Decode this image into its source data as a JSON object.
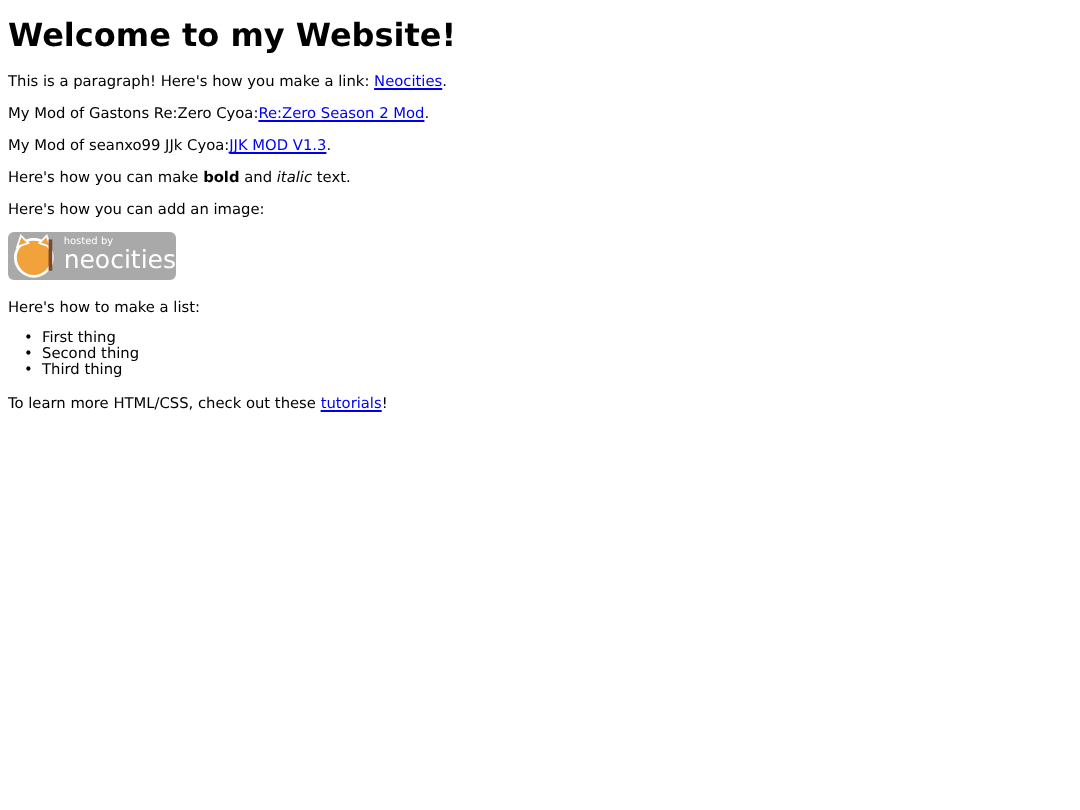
{
  "heading": "Welcome to my Website!",
  "blocks": [
    {
      "kind": "link_paragraph",
      "before": "This is a paragraph! Here's how you make a link: ",
      "link": "Neocities",
      "after": "."
    },
    {
      "kind": "link_paragraph",
      "before": "My Mod of Gastons Re:Zero Cyoa:",
      "link": "Re:Zero Season 2 Mod",
      "after": "."
    },
    {
      "kind": "link_paragraph",
      "before": "My Mod of seanxo99 JJk Cyoa:",
      "link": "JJK MOD V1.3",
      "after": "."
    },
    {
      "kind": "paragraph",
      "text": "Here's how you can make **bold** and *italic* text."
    },
    {
      "kind": "paragraph",
      "text": "Here's how you can add an image:"
    },
    {
      "kind": "badge",
      "small": "hosted by",
      "large": "neocities"
    },
    {
      "kind": "paragraph",
      "text": "Here's how to make a list:"
    },
    {
      "kind": "list",
      "items": [
        {
          "marker": "•",
          "text": "First thing"
        },
        {
          "marker": "•",
          "text": "Second thing"
        },
        {
          "marker": "•",
          "text": "Third thing"
        }
      ]
    },
    {
      "kind": "link_paragraph",
      "before": "To learn more HTML/CSS, check out these ",
      "link": "tutorials",
      "after": "!"
    }
  ]
}
